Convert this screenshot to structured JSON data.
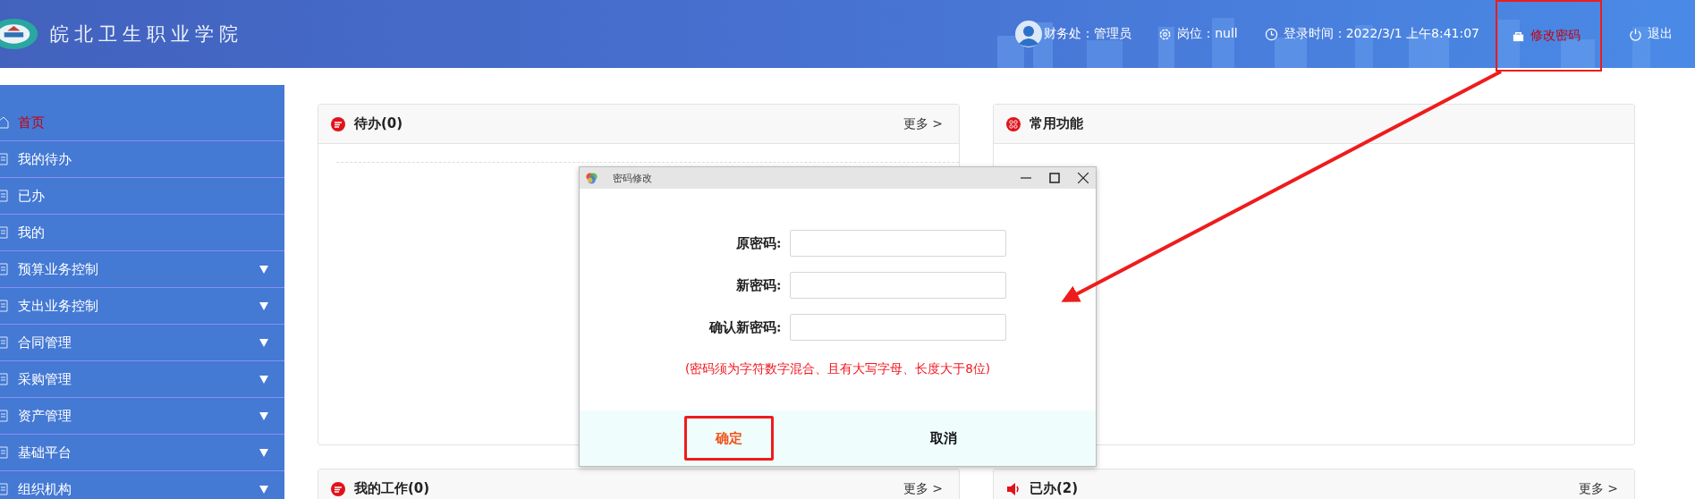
{
  "header": {
    "school_name": "皖北卫生职业学院",
    "user": "财务处：管理员",
    "post": "岗位：null",
    "login_time": "登录时间：2022/3/1 上午8:41:07",
    "change_password": {
      "label": "修改密码",
      "highlighted": true
    },
    "logout": "退出"
  },
  "sidebar": {
    "items": [
      {
        "label": "首页",
        "selected": true,
        "has_submenu": false
      },
      {
        "label": "我的待办",
        "selected": false,
        "has_submenu": false
      },
      {
        "label": "已办",
        "selected": false,
        "has_submenu": false
      },
      {
        "label": "我的",
        "selected": false,
        "has_submenu": false
      },
      {
        "label": "预算业务控制",
        "selected": false,
        "has_submenu": true
      },
      {
        "label": "支出业务控制",
        "selected": false,
        "has_submenu": true
      },
      {
        "label": "合同管理",
        "selected": false,
        "has_submenu": true
      },
      {
        "label": "采购管理",
        "selected": false,
        "has_submenu": true
      },
      {
        "label": "资产管理",
        "selected": false,
        "has_submenu": true
      },
      {
        "label": "基础平台",
        "selected": false,
        "has_submenu": true
      },
      {
        "label": "组织机构",
        "selected": false,
        "has_submenu": true
      }
    ]
  },
  "cards": [
    {
      "title": "待办(0)",
      "more": "更多 >"
    },
    {
      "title": "常用功能"
    },
    {
      "title": "我的工作(0)",
      "more": "更多 >"
    },
    {
      "title": "已办(2)",
      "more": "更多 >"
    }
  ],
  "dialog": {
    "title": "密码修改",
    "fields": [
      {
        "label": "原密码:"
      },
      {
        "label": "新密码:"
      },
      {
        "label": "确认新密码:"
      }
    ],
    "hint": "(密码须为字符数字混合、且有大写字母、长度大于8位)",
    "buttons": [
      {
        "label": "确定",
        "highlighted": true
      },
      {
        "label": "取消",
        "highlighted": false
      }
    ]
  }
}
